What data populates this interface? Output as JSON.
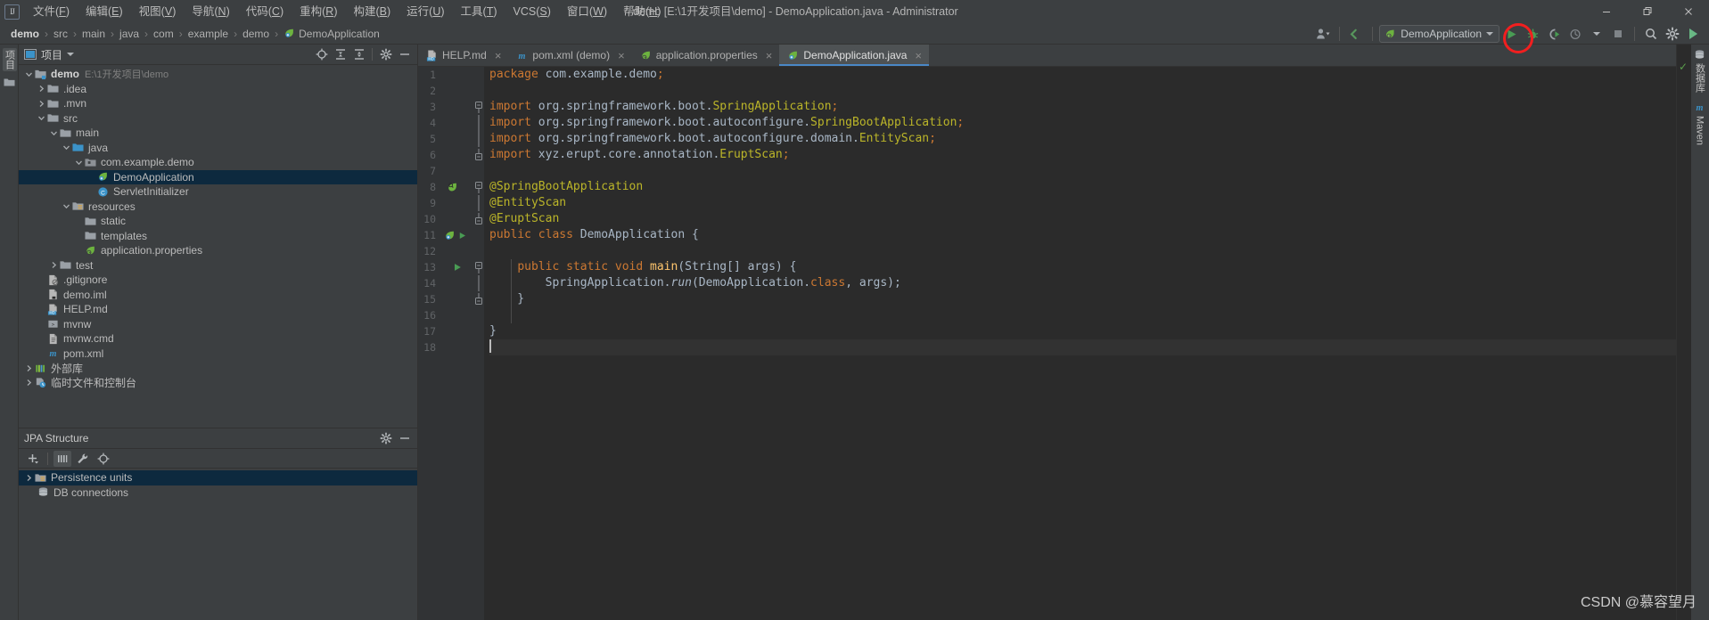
{
  "window": {
    "title": "demo [E:\\1开发项目\\demo] - DemoApplication.java - Administrator",
    "logo": "IJ",
    "controls": {
      "minimize": "minimize-icon",
      "maximize": "restore-icon",
      "close": "close-icon"
    }
  },
  "menubar": {
    "items": [
      {
        "label": "文件(F)"
      },
      {
        "label": "编辑(E)"
      },
      {
        "label": "视图(V)"
      },
      {
        "label": "导航(N)"
      },
      {
        "label": "代码(C)"
      },
      {
        "label": "重构(R)"
      },
      {
        "label": "构建(B)"
      },
      {
        "label": "运行(U)"
      },
      {
        "label": "工具(T)"
      },
      {
        "label": "VCS(S)"
      },
      {
        "label": "窗口(W)"
      },
      {
        "label": "帮助(H)"
      }
    ]
  },
  "breadcrumb": {
    "items": [
      {
        "label": "demo",
        "bold": true
      },
      {
        "label": "src",
        "bold": false
      },
      {
        "label": "main",
        "bold": false
      },
      {
        "label": "java",
        "bold": false
      },
      {
        "label": "com",
        "bold": false
      },
      {
        "label": "example",
        "bold": false
      },
      {
        "label": "demo",
        "bold": false
      },
      {
        "label": "DemoApplication",
        "bold": false,
        "icon": "spring-class-icon"
      }
    ],
    "separator": "›"
  },
  "toolbar": {
    "user_icon": "user-avatar-icon",
    "update_icon": "update-project-icon",
    "run_config_label": "DemoApplication",
    "run_config_icon": "spring-boot-icon",
    "run_button": "run-icon",
    "debug_button": "debug-icon",
    "run_coverage_button": "run-with-coverage-icon",
    "profiler_button": "profiler-icon",
    "stop_button": "stop-icon",
    "search_button": "search-icon",
    "settings_button": "gear-icon",
    "ide_help_button": "ide-features-trainer-icon",
    "annotation_color": "#f21f1f"
  },
  "left_strip": {
    "project_tab": "项目",
    "bookmarks_icon": "folder-icon"
  },
  "project_panel": {
    "title": "项目",
    "actions": [
      {
        "name": "locate-icon"
      },
      {
        "name": "expand-all-icon"
      },
      {
        "name": "collapse-all-icon"
      },
      {
        "name": "gear-icon"
      },
      {
        "name": "hide-icon"
      }
    ],
    "tree": [
      {
        "depth": 0,
        "label": "demo",
        "sub": "E:\\1开发项目\\demo",
        "icon": "module-folder-icon",
        "arrow": "down",
        "bold": true,
        "selected": false
      },
      {
        "depth": 1,
        "label": ".idea",
        "sub": "",
        "icon": "folder-icon",
        "arrow": "right",
        "bold": false,
        "selected": false
      },
      {
        "depth": 1,
        "label": ".mvn",
        "sub": "",
        "icon": "folder-icon",
        "arrow": "right",
        "bold": false,
        "selected": false
      },
      {
        "depth": 1,
        "label": "src",
        "sub": "",
        "icon": "folder-icon",
        "arrow": "down",
        "bold": false,
        "selected": false
      },
      {
        "depth": 2,
        "label": "main",
        "sub": "",
        "icon": "folder-icon",
        "arrow": "down",
        "bold": false,
        "selected": false
      },
      {
        "depth": 3,
        "label": "java",
        "sub": "",
        "icon": "source-folder-icon",
        "arrow": "down",
        "bold": false,
        "selected": false
      },
      {
        "depth": 4,
        "label": "com.example.demo",
        "sub": "",
        "icon": "package-icon",
        "arrow": "down",
        "bold": false,
        "selected": false
      },
      {
        "depth": 5,
        "label": "DemoApplication",
        "sub": "",
        "icon": "spring-class-icon",
        "arrow": "none",
        "bold": false,
        "selected": true
      },
      {
        "depth": 5,
        "label": "ServletInitializer",
        "sub": "",
        "icon": "java-class-icon",
        "arrow": "none",
        "bold": false,
        "selected": false
      },
      {
        "depth": 3,
        "label": "resources",
        "sub": "",
        "icon": "resource-folder-icon",
        "arrow": "down",
        "bold": false,
        "selected": false
      },
      {
        "depth": 4,
        "label": "static",
        "sub": "",
        "icon": "folder-icon",
        "arrow": "none",
        "bold": false,
        "selected": false
      },
      {
        "depth": 4,
        "label": "templates",
        "sub": "",
        "icon": "folder-icon",
        "arrow": "none",
        "bold": false,
        "selected": false
      },
      {
        "depth": 4,
        "label": "application.properties",
        "sub": "",
        "icon": "spring-properties-icon",
        "arrow": "none",
        "bold": false,
        "selected": false
      },
      {
        "depth": 2,
        "label": "test",
        "sub": "",
        "icon": "folder-icon",
        "arrow": "right",
        "bold": false,
        "selected": false
      },
      {
        "depth": 1,
        "label": ".gitignore",
        "sub": "",
        "icon": "gitignore-icon",
        "arrow": "none",
        "bold": false,
        "selected": false
      },
      {
        "depth": 1,
        "label": "demo.iml",
        "sub": "",
        "icon": "iml-file-icon",
        "arrow": "none",
        "bold": false,
        "selected": false
      },
      {
        "depth": 1,
        "label": "HELP.md",
        "sub": "",
        "icon": "markdown-icon",
        "arrow": "none",
        "bold": false,
        "selected": false
      },
      {
        "depth": 1,
        "label": "mvnw",
        "sub": "",
        "icon": "script-icon",
        "arrow": "none",
        "bold": false,
        "selected": false
      },
      {
        "depth": 1,
        "label": "mvnw.cmd",
        "sub": "",
        "icon": "cmd-file-icon",
        "arrow": "none",
        "bold": false,
        "selected": false
      },
      {
        "depth": 1,
        "label": "pom.xml",
        "sub": "",
        "icon": "maven-icon",
        "arrow": "none",
        "bold": false,
        "selected": false
      },
      {
        "depth": 0,
        "label": "外部库",
        "sub": "",
        "icon": "external-libraries-icon",
        "arrow": "right",
        "bold": false,
        "selected": false
      },
      {
        "depth": 0,
        "label": "临时文件和控制台",
        "sub": "",
        "icon": "scratches-icon",
        "arrow": "right",
        "bold": false,
        "selected": false
      }
    ]
  },
  "jpa_panel": {
    "title": "JPA Structure",
    "header_actions": [
      {
        "name": "gear-icon"
      },
      {
        "name": "hide-icon"
      }
    ],
    "toolbar": [
      {
        "name": "add-icon"
      },
      {
        "name": "columns-icon",
        "active": true
      },
      {
        "name": "wrench-icon",
        "active": false
      },
      {
        "name": "locate-icon",
        "active": false
      }
    ],
    "tree": [
      {
        "label": "Persistence units",
        "icon": "persistence-units-icon",
        "arrow": "right",
        "selected": true
      },
      {
        "label": "DB connections",
        "icon": "database-icon",
        "arrow": "none",
        "selected": false
      }
    ]
  },
  "editor": {
    "tabs": [
      {
        "label": "HELP.md",
        "icon": "markdown-icon",
        "active": false
      },
      {
        "label": "pom.xml (demo)",
        "icon": "maven-icon",
        "active": false
      },
      {
        "label": "application.properties",
        "icon": "spring-properties-icon",
        "active": false
      },
      {
        "label": "DemoApplication.java",
        "icon": "spring-class-icon",
        "active": true
      }
    ],
    "close_glyph": "×",
    "caret_line": 18,
    "lines": [
      {
        "n": 1,
        "gutter": "",
        "fold": "",
        "text": "package com.example.demo;"
      },
      {
        "n": 2,
        "gutter": "",
        "fold": "",
        "text": ""
      },
      {
        "n": 3,
        "gutter": "",
        "fold": "fold-start",
        "text": "import org.springframework.boot.SpringApplication;"
      },
      {
        "n": 4,
        "gutter": "",
        "fold": "",
        "text": "import org.springframework.boot.autoconfigure.SpringBootApplication;"
      },
      {
        "n": 5,
        "gutter": "",
        "fold": "",
        "text": "import org.springframework.boot.autoconfigure.domain.EntityScan;"
      },
      {
        "n": 6,
        "gutter": "",
        "fold": "fold-end",
        "text": "import xyz.erupt.core.annotation.EruptScan;"
      },
      {
        "n": 7,
        "gutter": "",
        "fold": "",
        "text": ""
      },
      {
        "n": 8,
        "gutter": "spring-bean-icon",
        "fold": "fold-start",
        "text": "@SpringBootApplication"
      },
      {
        "n": 9,
        "gutter": "",
        "fold": "",
        "text": "@EntityScan"
      },
      {
        "n": 10,
        "gutter": "",
        "fold": "fold-end",
        "text": "@EruptScan"
      },
      {
        "n": 11,
        "gutter": "spring-boot-run-icon",
        "fold": "",
        "text": "public class DemoApplication {"
      },
      {
        "n": 12,
        "gutter": "",
        "fold": "",
        "text": ""
      },
      {
        "n": 13,
        "gutter": "run-icon",
        "fold": "fold-start",
        "text": "    public static void main(String[] args) {"
      },
      {
        "n": 14,
        "gutter": "",
        "fold": "",
        "text": "        SpringApplication.run(DemoApplication.class, args);"
      },
      {
        "n": 15,
        "gutter": "",
        "fold": "fold-end",
        "text": "    }"
      },
      {
        "n": 16,
        "gutter": "",
        "fold": "",
        "text": ""
      },
      {
        "n": 17,
        "gutter": "",
        "fold": "",
        "text": "}"
      },
      {
        "n": 18,
        "gutter": "",
        "fold": "",
        "text": ""
      }
    ]
  },
  "right_strip": {
    "inspection_status": "✓",
    "tabs": [
      {
        "label": "数据库",
        "icon": "database-icon"
      },
      {
        "label": "Maven",
        "icon": "maven-icon"
      }
    ]
  },
  "watermark": "CSDN @慕容望月"
}
